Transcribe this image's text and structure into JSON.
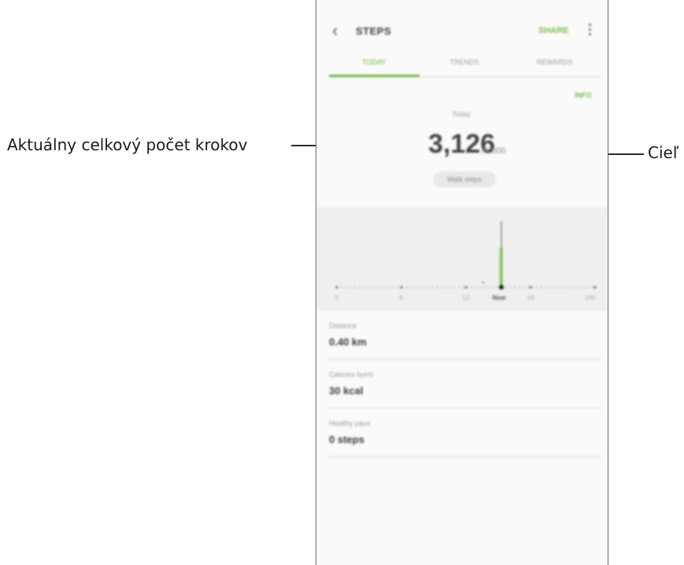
{
  "annotations": {
    "left_label": "Aktuálny celkový počet krokov",
    "right_label": "Cieľ"
  },
  "appbar": {
    "title": "STEPS",
    "share_label": "SHARE"
  },
  "tabs": [
    {
      "label": "TODAY",
      "active": true
    },
    {
      "label": "TRENDS",
      "active": false
    },
    {
      "label": "REWARDS",
      "active": false
    }
  ],
  "summary": {
    "info_label": "INFO",
    "today_label": "Today",
    "step_count": "3,126",
    "goal_text": "/6,000",
    "pill_text": "Walk steps"
  },
  "chart_data": {
    "type": "bar",
    "x_labels": [
      "0",
      "6",
      "12",
      "Now",
      "18",
      "24h"
    ],
    "highlight_label": "Now"
  },
  "stats": [
    {
      "label": "Distance",
      "value": "0.40 km"
    },
    {
      "label": "Calories burnt",
      "value": "30 kcal"
    },
    {
      "label": "Healthy pace",
      "value": "0 steps"
    }
  ],
  "colors": {
    "accent": "#6fb53f",
    "bar_green": "#7cbd4c",
    "chart_bg": "#efefef"
  }
}
